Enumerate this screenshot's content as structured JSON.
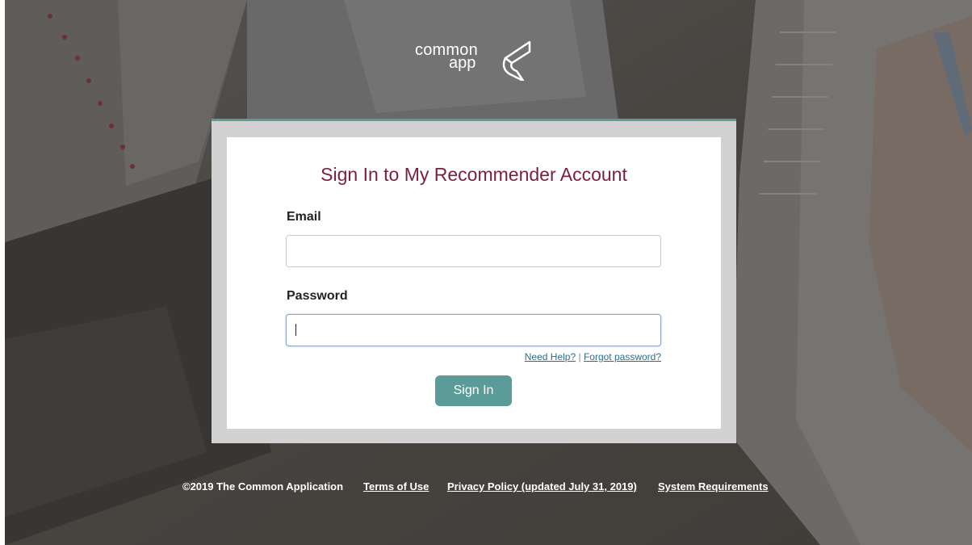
{
  "logo": {
    "word1": "common",
    "word2": "app",
    "icon": "common-app-logo-mark"
  },
  "form": {
    "title": "Sign In to My Recommender Account",
    "email_label": "Email",
    "email_value": "",
    "password_label": "Password",
    "password_value": "",
    "need_help": "Need Help?",
    "separator": "|",
    "forgot_password": "Forgot password?",
    "signin_label": "Sign In"
  },
  "footer": {
    "copyright": "©2019 The Common Application",
    "terms": "Terms of Use",
    "privacy": "Privacy Policy (updated July 31, 2019)",
    "system": "System Requirements"
  },
  "colors": {
    "title": "#7b1f3f",
    "accent": "#5b9b98",
    "link": "#2b6f8a"
  }
}
